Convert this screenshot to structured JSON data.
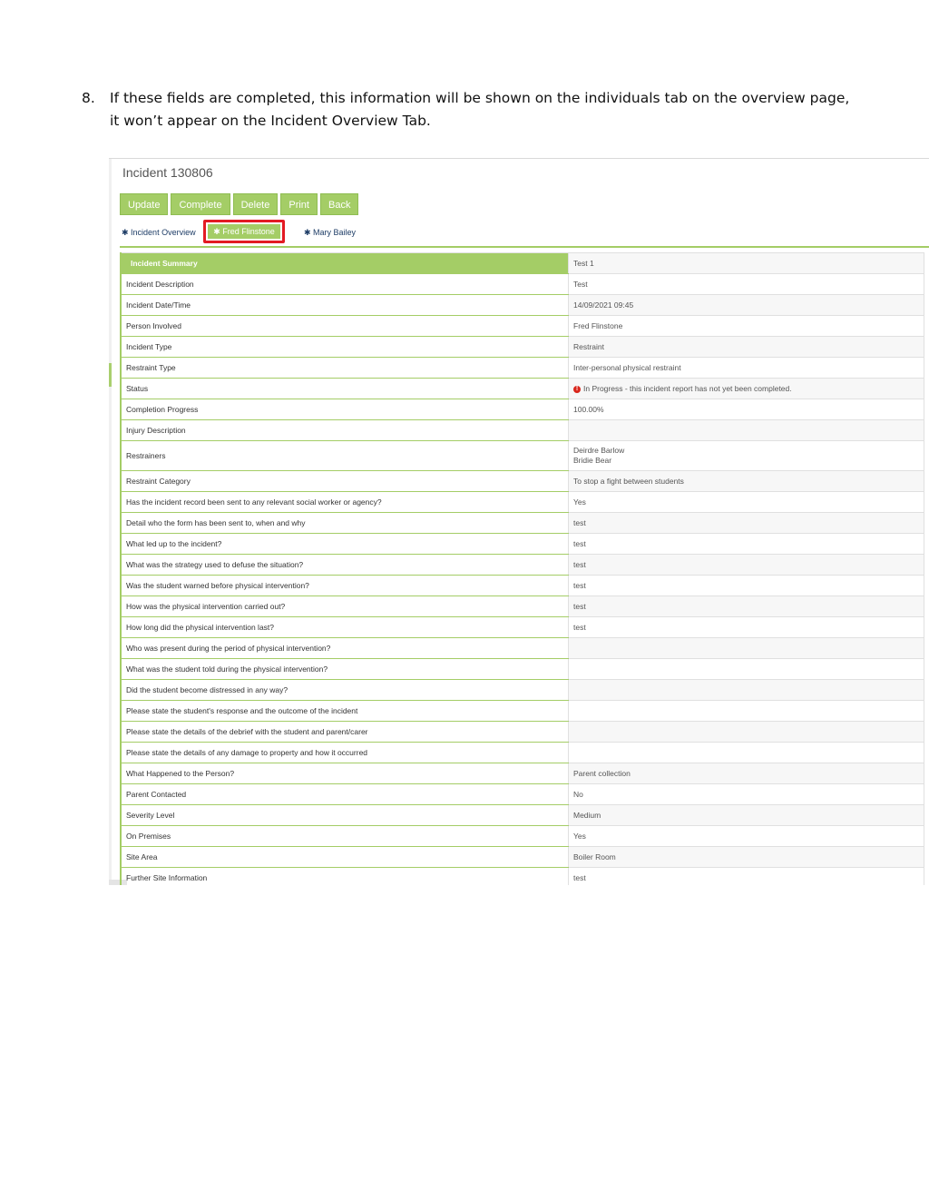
{
  "instruction": {
    "number": "8.",
    "text": "If these fields are completed, this information will be shown on the individuals tab on the overview page, it won’t appear on the Incident Overview Tab."
  },
  "app": {
    "title": "Incident 130806",
    "buttons": [
      "Update",
      "Complete",
      "Delete",
      "Print",
      "Back"
    ],
    "tabs": [
      "✱ Incident Overview",
      "✱ Fred Flinstone",
      "✱ Mary Bailey"
    ],
    "highlight_color": "#e31b23",
    "accent_color": "#a4cd66"
  },
  "rows": [
    {
      "label": "Incident Summary",
      "value": "Test 1"
    },
    {
      "label": "Incident Description",
      "value": "Test"
    },
    {
      "label": "Incident Date/Time",
      "value": "14/09/2021 09:45"
    },
    {
      "label": "Person Involved",
      "value": "Fred Flinstone"
    },
    {
      "label": "Incident Type",
      "value": "Restraint"
    },
    {
      "label": "Restraint Type",
      "value": "Inter-personal physical restraint"
    },
    {
      "label": "Status",
      "value": "In Progress - this incident report has not yet been completed.",
      "icon": "warning-icon"
    },
    {
      "label": "Completion Progress",
      "value": "100.00%"
    },
    {
      "label": "Injury Description",
      "value": ""
    },
    {
      "label": "Restrainers",
      "value_lines": [
        "Deirdre Barlow",
        "Bridie Bear"
      ]
    },
    {
      "label": "Restraint Category",
      "value": "To stop a fight between students"
    },
    {
      "label": "Has the incident record been sent to any relevant social worker or agency?",
      "value": "Yes"
    },
    {
      "label": "Detail who the form has been sent to, when and why",
      "value": "test"
    },
    {
      "label": "What led up to the incident?",
      "value": "test"
    },
    {
      "label": "What was the strategy used to defuse the situation?",
      "value": "test"
    },
    {
      "label": "Was the student warned before physical intervention?",
      "value": "test"
    },
    {
      "label": "How was the physical intervention carried out?",
      "value": "test"
    },
    {
      "label": "How long did the physical intervention last?",
      "value": "test"
    },
    {
      "label": "Who was present during the period of physical intervention?",
      "value": ""
    },
    {
      "label": "What was the student told during the physical intervention?",
      "value": ""
    },
    {
      "label": "Did the student become distressed in any way?",
      "value": ""
    },
    {
      "label": "Please state the student's response and the outcome of the incident",
      "value": ""
    },
    {
      "label": "Please state the details of the debrief with the student and parent/carer",
      "value": ""
    },
    {
      "label": "Please state the details of any damage to property and how it occurred",
      "value": ""
    },
    {
      "label": "What Happened to the Person?",
      "value": "Parent collection"
    },
    {
      "label": "Parent Contacted",
      "value": "No"
    },
    {
      "label": "Severity Level",
      "value": "Medium"
    },
    {
      "label": "On Premises",
      "value": "Yes"
    },
    {
      "label": "Site Area",
      "value": "Boiler Room"
    },
    {
      "label": "Further Site Information",
      "value": "test"
    }
  ]
}
